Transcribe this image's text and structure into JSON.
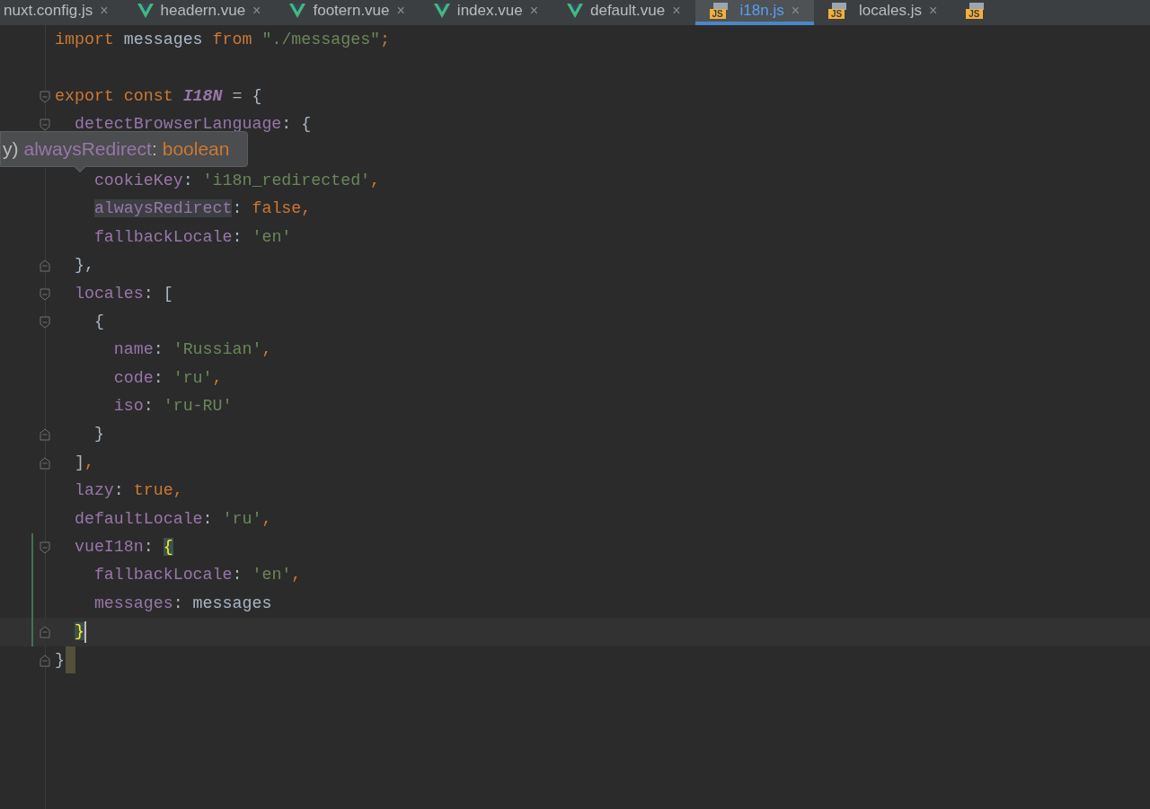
{
  "tabs": [
    {
      "label": "nuxt.config.js",
      "kind": "plain",
      "close": "×",
      "selected": false
    },
    {
      "label": "headern.vue",
      "kind": "vue",
      "close": "×",
      "selected": false
    },
    {
      "label": "footern.vue",
      "kind": "vue",
      "close": "×",
      "selected": false
    },
    {
      "label": "index.vue",
      "kind": "vue",
      "close": "×",
      "selected": false
    },
    {
      "label": "default.vue",
      "kind": "vue",
      "close": "×",
      "selected": false
    },
    {
      "label": "i18n.js",
      "kind": "js",
      "badge": "JS",
      "close": "×",
      "selected": true
    },
    {
      "label": "locales.js",
      "kind": "js",
      "badge": "JS",
      "close": "×",
      "selected": false
    },
    {
      "kind": "js",
      "badge": "JS",
      "selected": false
    }
  ],
  "editor": {
    "lines": [
      {
        "kind": "plain",
        "tokens": [
          {
            "t": "import",
            "kind": "keyword"
          },
          {
            "t": " messages ",
            "kind": "text"
          },
          {
            "t": "from",
            "kind": "keyword"
          },
          {
            "t": " \"./messages\"",
            "kind": "string"
          },
          {
            "t": ";",
            "kind": "punct"
          }
        ]
      },
      {
        "kind": "plain"
      },
      {
        "kind": "fold-open",
        "tokens": [
          {
            "t": "export const",
            "kind": "keyword"
          },
          {
            "t": " I18N",
            "kind": "const"
          },
          {
            "t": " = {",
            "kind": "text"
          }
        ]
      },
      {
        "kind": "fold-open",
        "tokens": [
          {
            "t": "  detectBrowserLanguage",
            "kind": "prop"
          },
          {
            "t": ": {",
            "kind": "text"
          }
        ]
      },
      {
        "kind": "plain"
      },
      {
        "kind": "plain",
        "tokens": [
          {
            "t": "    cookieKey",
            "kind": "prop"
          },
          {
            "t": ": ",
            "kind": "text"
          },
          {
            "t": "'i18n_redirected'",
            "kind": "string"
          },
          {
            "t": ",",
            "kind": "punct"
          }
        ]
      },
      {
        "kind": "plain",
        "tokens": [
          {
            "t": "    alwaysRedirect",
            "kind": "prop-highlight"
          },
          {
            "t": ": ",
            "kind": "text"
          },
          {
            "t": "false",
            "kind": "keyword"
          },
          {
            "t": ",",
            "kind": "punct"
          }
        ]
      },
      {
        "kind": "plain",
        "tokens": [
          {
            "t": "    fallbackLocale",
            "kind": "prop"
          },
          {
            "t": ": ",
            "kind": "text"
          },
          {
            "t": "'en'",
            "kind": "string"
          }
        ]
      },
      {
        "kind": "fold-close",
        "tokens": [
          {
            "t": "  },",
            "kind": "text"
          }
        ]
      },
      {
        "kind": "fold-open",
        "tokens": [
          {
            "t": "  locales",
            "kind": "prop"
          },
          {
            "t": ": [",
            "kind": "text"
          }
        ]
      },
      {
        "kind": "fold-open",
        "tokens": [
          {
            "t": "    {",
            "kind": "text"
          }
        ]
      },
      {
        "kind": "plain",
        "tokens": [
          {
            "t": "      name",
            "kind": "prop"
          },
          {
            "t": ": ",
            "kind": "text"
          },
          {
            "t": "'Russian'",
            "kind": "string"
          },
          {
            "t": ",",
            "kind": "punct"
          }
        ]
      },
      {
        "kind": "plain",
        "tokens": [
          {
            "t": "      code",
            "kind": "prop"
          },
          {
            "t": ": ",
            "kind": "text"
          },
          {
            "t": "'ru'",
            "kind": "string"
          },
          {
            "t": ",",
            "kind": "punct"
          }
        ]
      },
      {
        "kind": "plain",
        "tokens": [
          {
            "t": "      iso",
            "kind": "prop"
          },
          {
            "t": ": ",
            "kind": "text"
          },
          {
            "t": "'ru-RU'",
            "kind": "string"
          }
        ]
      },
      {
        "kind": "fold-close",
        "tokens": [
          {
            "t": "    }",
            "kind": "text"
          }
        ]
      },
      {
        "kind": "fold-close",
        "tokens": [
          {
            "t": "  ]",
            "kind": "text"
          },
          {
            "t": ",",
            "kind": "punct"
          }
        ]
      },
      {
        "kind": "plain",
        "tokens": [
          {
            "t": "  lazy",
            "kind": "prop"
          },
          {
            "t": ": ",
            "kind": "text"
          },
          {
            "t": "true",
            "kind": "keyword"
          },
          {
            "t": ",",
            "kind": "punct"
          }
        ]
      },
      {
        "kind": "plain",
        "tokens": [
          {
            "t": "  defaultLocale",
            "kind": "prop"
          },
          {
            "t": ": ",
            "kind": "text"
          },
          {
            "t": "'ru'",
            "kind": "string"
          },
          {
            "t": ",",
            "kind": "punct"
          }
        ]
      },
      {
        "kind": "fold-open",
        "changed": true,
        "tokens": [
          {
            "t": "  vueI18n",
            "kind": "prop"
          },
          {
            "t": ": ",
            "kind": "text"
          },
          {
            "t": "{",
            "kind": "brace-match"
          }
        ]
      },
      {
        "kind": "plain",
        "changed": true,
        "tokens": [
          {
            "t": "    fallbackLocale",
            "kind": "prop"
          },
          {
            "t": ": ",
            "kind": "text"
          },
          {
            "t": "'en'",
            "kind": "string"
          },
          {
            "t": ",",
            "kind": "punct"
          }
        ]
      },
      {
        "kind": "plain",
        "changed": true,
        "tokens": [
          {
            "t": "    messages",
            "kind": "prop"
          },
          {
            "t": ": messages",
            "kind": "text"
          }
        ]
      },
      {
        "kind": "fold-close",
        "changed": true,
        "current": true,
        "tokens": [
          {
            "t": "  }",
            "kind": "brace-match"
          }
        ]
      },
      {
        "kind": "fold-close",
        "trailing_block": true,
        "tokens": [
          {
            "t": "}",
            "kind": "text"
          }
        ]
      }
    ]
  },
  "tooltip": {
    "prefix": "y)",
    "name": "alwaysRedirect",
    "separator": ":",
    "type": "boolean"
  }
}
